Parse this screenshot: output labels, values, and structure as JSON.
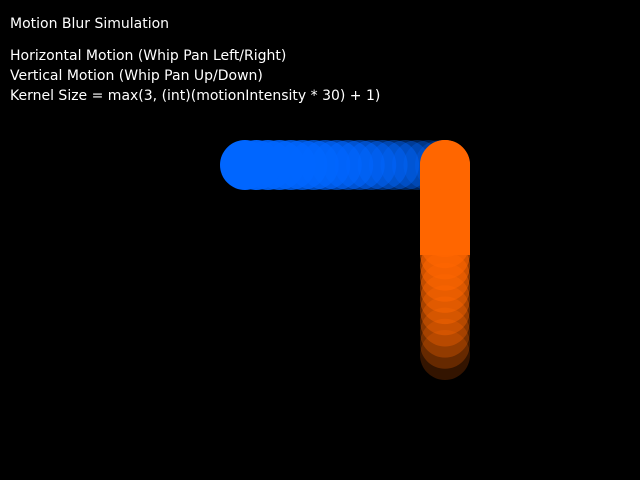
{
  "window": {
    "title": "Motion Blur Simulation"
  },
  "info": {
    "horizontal_label": "Horizontal Motion (Whip Pan Left/Right)",
    "vertical_label": "Vertical Motion (Whip Pan Up/Down)",
    "kernel_formula": "Kernel Size = max(3, (int)(motionIntensity * 30) + 1)"
  },
  "colors": {
    "background": "#000000",
    "text": "#ffffff",
    "horizontal_blur": "#0066ff",
    "vertical_blur": "#ff6600"
  }
}
